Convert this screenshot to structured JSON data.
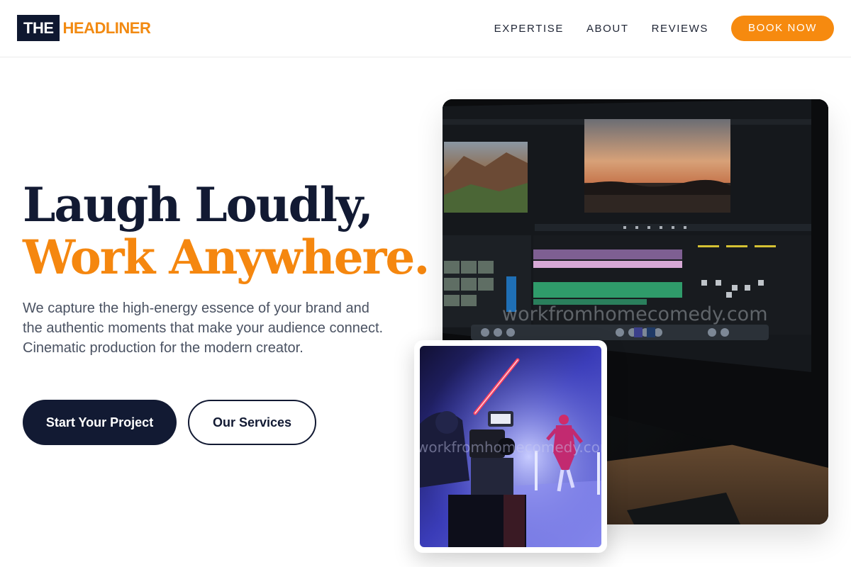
{
  "header": {
    "logo": {
      "part1": "THE",
      "part2": "HEADLINER"
    },
    "nav": [
      {
        "label": "EXPERTISE"
      },
      {
        "label": "ABOUT"
      },
      {
        "label": "REVIEWS"
      }
    ],
    "cta_label": "BOOK NOW"
  },
  "hero": {
    "headline_line1": "Laugh Loudly,",
    "headline_line2": "Work Anywhere.",
    "description": "We capture the high-energy essence of your brand and the authentic moments that make your audience connect. Cinematic production for the modern creator.",
    "primary_button": "Start Your Project",
    "secondary_button": "Our Services"
  },
  "images": {
    "main_watermark": "workfromhomecomedy.com",
    "sub_watermark": "workfromhomecomedy.com"
  },
  "colors": {
    "navy": "#121a33",
    "accent_orange": "#f5870f",
    "body_text": "#4a5262"
  }
}
